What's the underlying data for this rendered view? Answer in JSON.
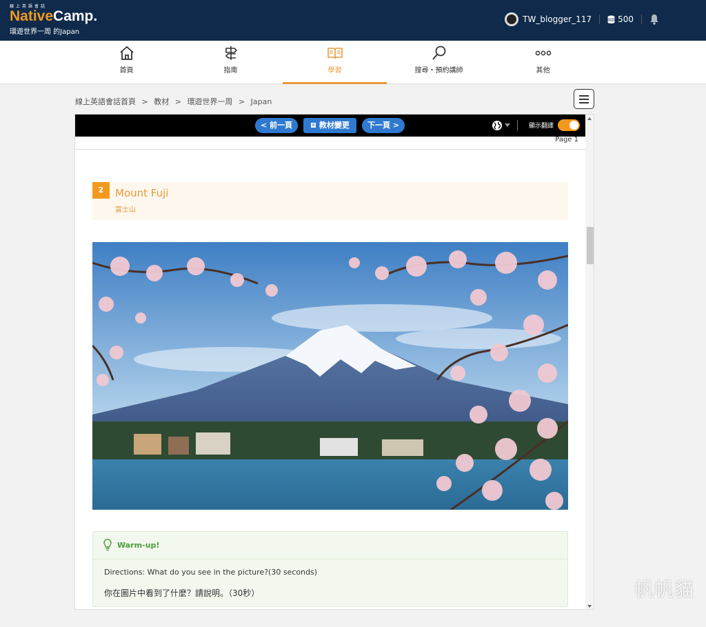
{
  "header": {
    "logo_small": "線上英語會話",
    "logo_native": "Native",
    "logo_camp": "Camp.",
    "logo_sub": "環遊世界一周 的Japan",
    "username": "TW_blogger_117",
    "coins": "500"
  },
  "nav": {
    "items": [
      {
        "label": "首頁",
        "icon": "home-icon"
      },
      {
        "label": "指南",
        "icon": "signpost-icon"
      },
      {
        "label": "學習",
        "icon": "book-icon"
      },
      {
        "label": "搜尋・預約講師",
        "icon": "search-icon"
      },
      {
        "label": "其他",
        "icon": "more-icon"
      }
    ],
    "active_color": "#e99a3a"
  },
  "breadcrumb": [
    "線上英語會話首頁",
    ">",
    "教材",
    ">",
    "環遊世界一周",
    ">",
    "Japan"
  ],
  "toolbar": {
    "prev": "< 前一頁",
    "change": "教材變更",
    "next": "下一頁 >",
    "translate_label": "顯示翻譯",
    "translate_on": true
  },
  "page_label": "Page 1",
  "lesson": {
    "number": "2",
    "title": "Mount Fuji",
    "subtitle": "富士山"
  },
  "warmup": {
    "title": "Warm-up!",
    "directions": "Directions: What do you see in the picture?(30 seconds)",
    "directions_zh": "你在圖片中看到了什麼？請說明。（30秒）"
  },
  "watermark": "帆帆貓",
  "colors": {
    "header_bg": "#0f2a4a",
    "accent": "#f29a1e",
    "button_blue": "#2f7ad0",
    "green": "#4e9b3a"
  }
}
